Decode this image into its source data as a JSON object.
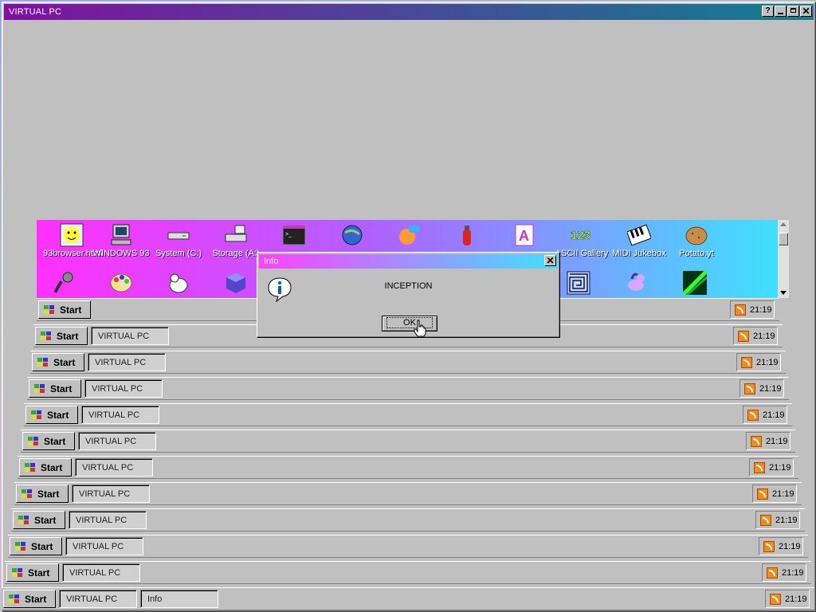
{
  "window_title": "VIRTUAL PC",
  "task_label": "VIRTUAL PC",
  "start_label": "Start",
  "clock": "21:19",
  "info_task_label": "Info",
  "icons_row1": [
    {
      "label": "93browser.html",
      "icon": "smiley-browser-icon"
    },
    {
      "label": "WINDOWS 93",
      "icon": "computer-icon"
    },
    {
      "label": "System (C:)",
      "icon": "drive-icon"
    },
    {
      "label": "Storage (A:)",
      "icon": "floppy-drive-icon"
    },
    {
      "label": "",
      "icon": "terminal-icon"
    },
    {
      "label": "",
      "icon": "globe-cat-icon"
    },
    {
      "label": "",
      "icon": "chat-smiley-icon"
    },
    {
      "label": "",
      "icon": "fire-extinguisher-icon"
    },
    {
      "label": "",
      "icon": "font-icon"
    },
    {
      "label": "ASCII Gallery",
      "icon": "numbers-icon"
    },
    {
      "label": "MIDI Jukebox",
      "icon": "piano-icon"
    },
    {
      "label": "Potato.yt",
      "icon": "potato-icon"
    }
  ],
  "icons_row2": [
    {
      "label": "",
      "icon": "microphone-icon"
    },
    {
      "label": "",
      "icon": "paint-palette-icon"
    },
    {
      "label": "",
      "icon": "cat-icon"
    },
    {
      "label": "",
      "icon": "cube-icon"
    },
    {
      "label": "",
      "icon": "maze-icon"
    },
    {
      "label": "",
      "icon": "pony-icon"
    },
    {
      "label": "",
      "icon": "green-image-icon"
    }
  ],
  "dialog": {
    "title": "Info",
    "message": "INCEPTION",
    "ok_label": "OK",
    "icon": "info-icon"
  },
  "colors": {
    "titlebar_start": "#ff30ff",
    "titlebar_end": "#40f0ff",
    "top_titlebar_start": "#8010a0",
    "top_titlebar_end": "#108090",
    "window_face": "#c0c0c0"
  }
}
